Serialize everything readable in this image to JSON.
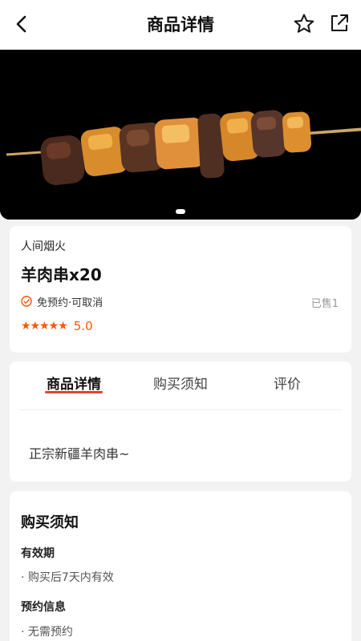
{
  "nav": {
    "title": "商品详情",
    "back_icon": "chevron-left-icon",
    "favorite_icon": "star-outline-icon",
    "share_icon": "share-icon"
  },
  "hero": {
    "image": "lamb-skewer-photo",
    "page_indicator": {
      "current": 1,
      "total": 1
    }
  },
  "product": {
    "shop_name": "人间烟火",
    "name": "羊肉串x20",
    "tag": "免预约·可取消",
    "sold": "已售1",
    "stars": "★★★★★",
    "score": "5.0"
  },
  "tabs": [
    {
      "label": "商品详情",
      "active": true
    },
    {
      "label": "购买须知",
      "active": false
    },
    {
      "label": "评价",
      "active": false
    }
  ],
  "detail": {
    "description": "正宗新疆羊肉串~"
  },
  "notice": {
    "title": "购买须知",
    "sections": [
      {
        "label": "有效期",
        "item": "· 购买后7天内有效"
      },
      {
        "label": "预约信息",
        "item": "· 无需预约"
      }
    ]
  },
  "colors": {
    "accent": "#ff5500",
    "tab_underline": "#e8402e"
  }
}
